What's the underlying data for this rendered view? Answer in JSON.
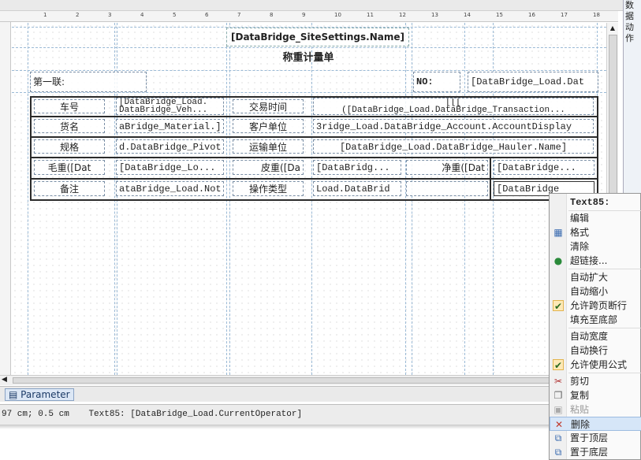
{
  "rulers": {
    "top_numbers": [
      "1",
      "2",
      "3",
      "4",
      "5",
      "6",
      "7",
      "8",
      "9",
      "10",
      "11",
      "12",
      "13",
      "14",
      "15",
      "16",
      "17",
      "18"
    ]
  },
  "report": {
    "site_name": "[DataBridge_SiteSettings.Name]",
    "title": "称重计量单",
    "copy_label": "第一联:",
    "no_label": "NO:",
    "no_value": "[DataBridge_Load.Dat",
    "rows": [
      {
        "label1": "车号",
        "value1": "[DataBridge_Load.",
        "value1b": "DataBridge_Veh...",
        "label2": "交易时间",
        "value2": "[[[",
        "value2b": "([DataBridge_Load.DataBridge_Transaction..."
      },
      {
        "label1": "货名",
        "value1": "aBridge_Material.]",
        "label2": "客户单位",
        "value2": "3ridge_Load.DataBridge_Account.AccountDisplay"
      },
      {
        "label1": "规格",
        "value1": "d.DataBridge_Pivot",
        "label2": "运输单位",
        "value2": "[DataBridge_Load.DataBridge_Hauler.Name]"
      },
      {
        "label1": "毛重([Dat",
        "value1": "[DataBridge_Lo...",
        "label2": "皮重([Da",
        "value2": "[DataBridg...",
        "label3": "净重([Dat",
        "value3": "[DataBridge..."
      },
      {
        "label1": "备注",
        "value1": "ataBridge_Load.Not",
        "label2": "操作类型",
        "value2": "Load.DataBrid",
        "value3": "[DataBridge"
      }
    ]
  },
  "right_panel": {
    "title1": "数据",
    "title2": "动作"
  },
  "tabs": {
    "parameter": "Parameter"
  },
  "status": {
    "position": "97 cm; 0.5 cm",
    "info": "Text85:  [DataBridge_Load.CurrentOperator]"
  },
  "menu": {
    "header": "Text85:",
    "items": [
      "编辑",
      "格式",
      "清除",
      "超链接...",
      "自动扩大",
      "自动缩小",
      "允许跨页断行",
      "填充至底部",
      "自动宽度",
      "自动换行",
      "允许使用公式",
      "剪切",
      "复制",
      "粘贴",
      "删除",
      "置于顶层",
      "置于底层"
    ]
  }
}
